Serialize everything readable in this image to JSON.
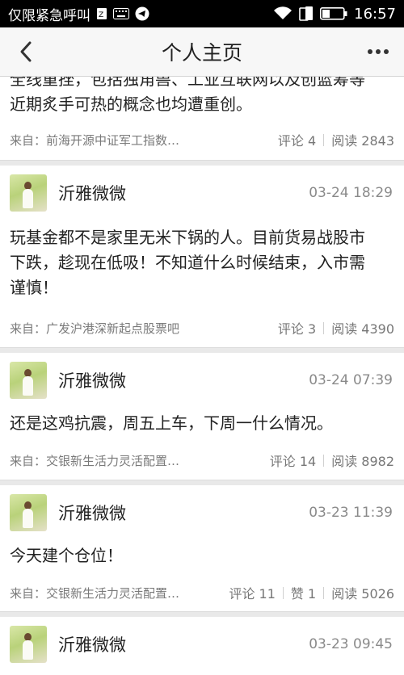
{
  "status_bar": {
    "left_text": "仅限紧急呼叫",
    "icons_left": [
      "signal-card-icon",
      "keyboard-icon",
      "telegram-icon"
    ],
    "icons_right": [
      "wifi-icon",
      "sim-icon",
      "battery-icon"
    ],
    "time": "16:57"
  },
  "nav": {
    "title": "个人主页",
    "back_icon": "chevron-left-icon",
    "more_icon": "more-dots-icon"
  },
  "partial_post": {
    "line1": "全线重挫，包括独角兽、工业互联网以及创蓝筹等",
    "line2": "近期炙手可热的概念也均遭重创。",
    "source": "来自：前海开源中证军工指数…",
    "comments": "评论 4",
    "reads": "阅读 2843"
  },
  "posts": [
    {
      "author": "沂雅微微",
      "time": "03-24 18:29",
      "lines": [
        "玩基金都不是家里无米下锅的人。目前货易战股市",
        "下跌，趁现在低吸！不知道什么时候结束，入市需",
        "谨慎！"
      ],
      "source": "来自：广发沪港深新起点股票吧",
      "comments": "评论 3",
      "reads": "阅读 4390"
    },
    {
      "author": "沂雅微微",
      "time": "03-24 07:39",
      "lines": [
        "还是这鸡抗震，周五上车，下周一什么情况。"
      ],
      "source": "来自：交银新生活力灵活配置…",
      "comments": "评论 14",
      "reads": "阅读 8982"
    },
    {
      "author": "沂雅微微",
      "time": "03-23 11:39",
      "lines": [
        "今天建个仓位！"
      ],
      "source": "来自：交银新生活力灵活配置…",
      "comments": "评论 11",
      "likes": "赞 1",
      "reads": "阅读 5026"
    },
    {
      "author": "沂雅微微",
      "time": "03-23 09:45"
    }
  ]
}
